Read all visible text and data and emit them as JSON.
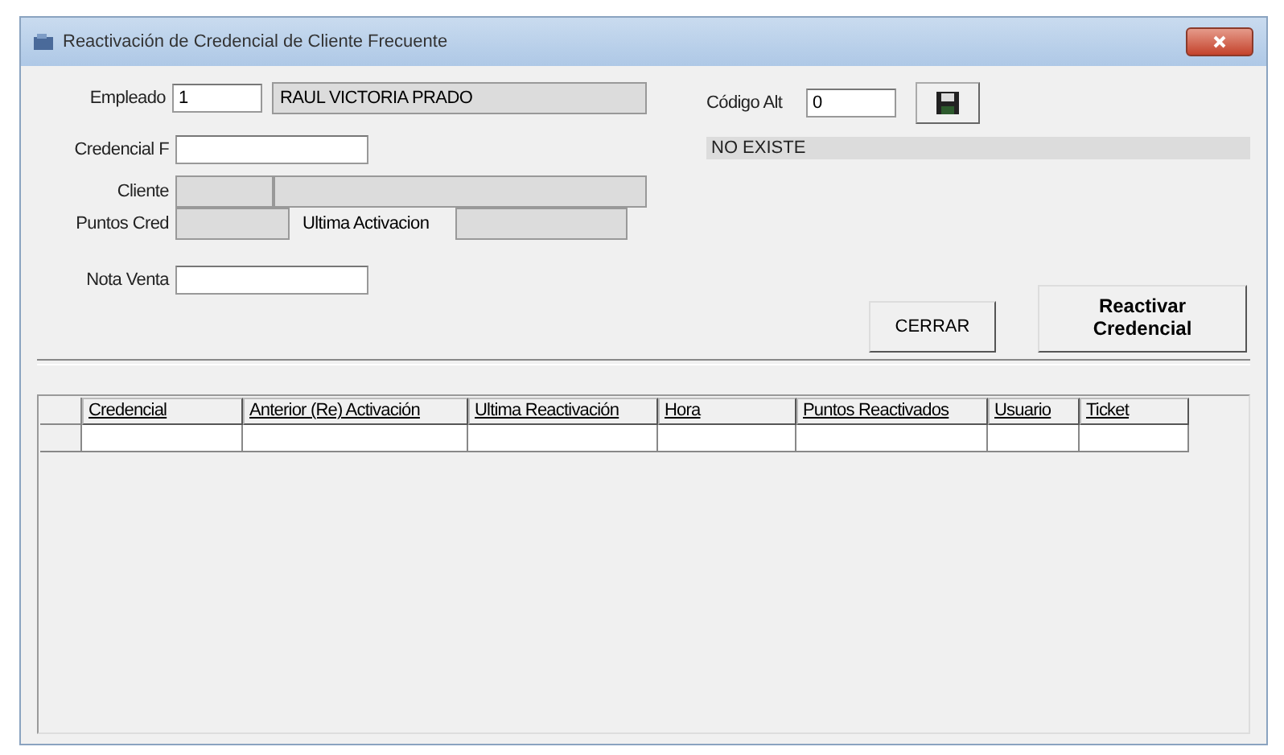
{
  "window": {
    "title": "Reactivación de Credencial de Cliente Frecuente"
  },
  "form": {
    "empleado": {
      "label": "Empleado",
      "value": "1",
      "name": "RAUL VICTORIA PRADO"
    },
    "credencial": {
      "label": "Credencial F"
    },
    "cliente": {
      "label": "Cliente"
    },
    "puntos": {
      "label": "Puntos Cred",
      "ultima_label": "Ultima Activacion"
    },
    "nota": {
      "label": "Nota Venta"
    },
    "codigo": {
      "label": "Código Alt",
      "value": "0"
    },
    "status": "NO EXISTE"
  },
  "buttons": [
    {
      "label": "CERRAR",
      "kind": "plain"
    },
    {
      "label": "Reactivar Credencial",
      "kind": "default"
    }
  ],
  "table": {
    "columns": [
      {
        "label": "Credencial"
      },
      {
        "label": "Anterior (Re) Activación"
      },
      {
        "label": "Ultima Reactivación"
      },
      {
        "label": "Hora"
      },
      {
        "label": "Puntos Reactivados"
      },
      {
        "label": "Usuario"
      },
      {
        "label": "Ticket"
      }
    ]
  }
}
